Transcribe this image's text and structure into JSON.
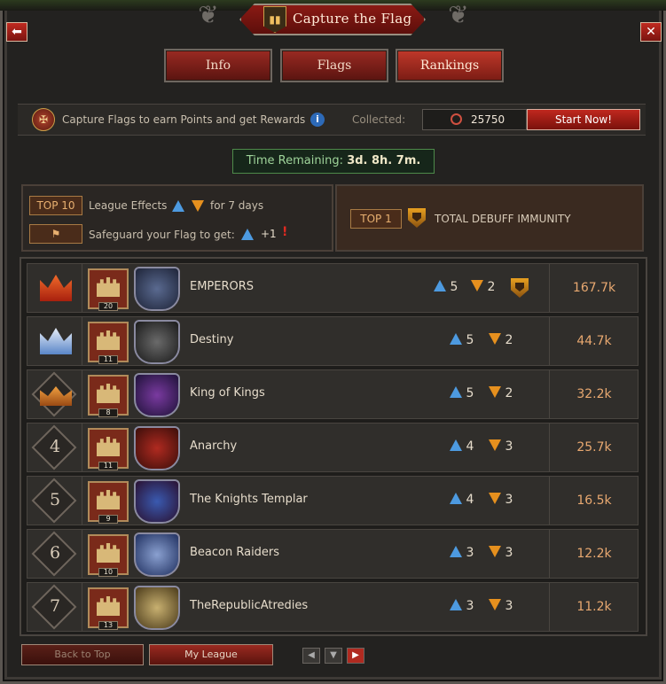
{
  "window": {
    "title": "Capture the Flag",
    "back_icon": "back-arrow-icon",
    "close_icon": "close-icon"
  },
  "tabs": [
    {
      "label": "Info",
      "active": false
    },
    {
      "label": "Flags",
      "active": false
    },
    {
      "label": "Rankings",
      "active": true
    }
  ],
  "info_bar": {
    "text": "Capture Flags to earn Points and get Rewards",
    "collected_label": "Collected:",
    "collected_value": "25750",
    "start_button": "Start Now!"
  },
  "time": {
    "label": "Time Remaining:",
    "value": "3d. 8h. 7m."
  },
  "effects": {
    "top10_badge": "TOP 10",
    "league_effects_label": "League Effects",
    "for_days": "for 7 days",
    "safeguard_text": "Safeguard your Flag to get:",
    "safeguard_bonus": "+1",
    "top1_badge": "TOP 1",
    "top1_effect": "TOTAL DEBUFF IMMUNITY"
  },
  "rows": [
    {
      "rank": "",
      "rank_icon": "gold-crown-icon",
      "castle_level": "20",
      "name": "EMPERORS",
      "blue": "5",
      "orange": "2",
      "shield": true,
      "score": "167.7k"
    },
    {
      "rank": "",
      "rank_icon": "silver-crown-icon",
      "castle_level": "11",
      "name": "Destiny",
      "blue": "5",
      "orange": "2",
      "shield": false,
      "score": "44.7k"
    },
    {
      "rank": "",
      "rank_icon": "bronze-crown-icon",
      "castle_level": "8",
      "name": "King of Kings",
      "blue": "5",
      "orange": "2",
      "shield": false,
      "score": "32.2k"
    },
    {
      "rank": "4",
      "rank_icon": "",
      "castle_level": "11",
      "name": "Anarchy",
      "blue": "4",
      "orange": "3",
      "shield": false,
      "score": "25.7k"
    },
    {
      "rank": "5",
      "rank_icon": "",
      "castle_level": "9",
      "name": "The Knights Templar",
      "blue": "4",
      "orange": "3",
      "shield": false,
      "score": "16.5k"
    },
    {
      "rank": "6",
      "rank_icon": "",
      "castle_level": "10",
      "name": "Beacon Raiders",
      "blue": "3",
      "orange": "3",
      "shield": false,
      "score": "12.2k"
    },
    {
      "rank": "7",
      "rank_icon": "",
      "castle_level": "13",
      "name": "TheRepublicAtredies",
      "blue": "3",
      "orange": "3",
      "shield": false,
      "score": "11.2k"
    }
  ],
  "bottom": {
    "back_to_top": "Back to Top",
    "my_league": "My League"
  }
}
